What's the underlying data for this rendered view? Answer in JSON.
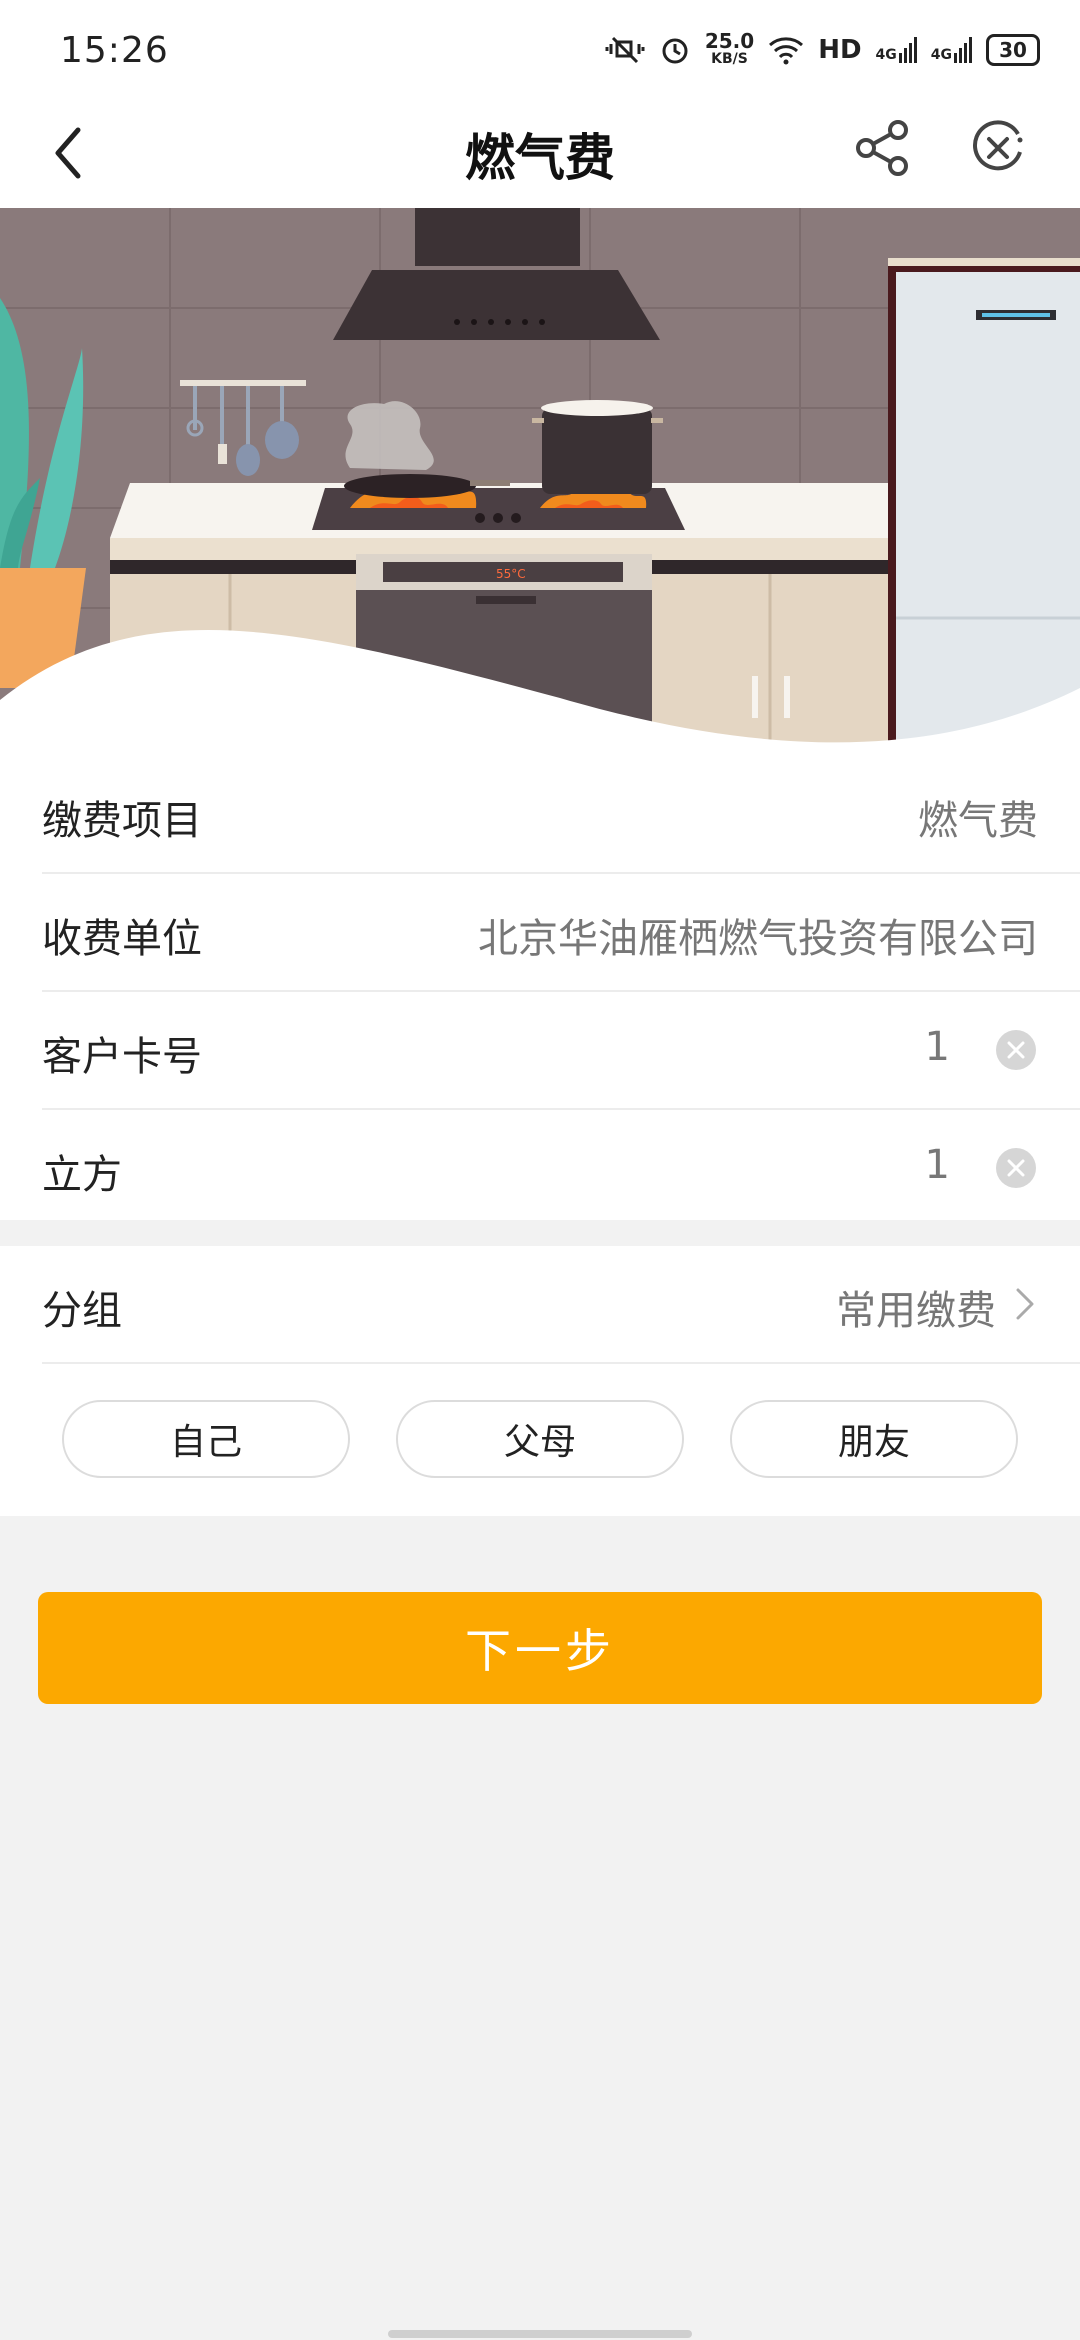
{
  "status": {
    "time": "15:26",
    "net_speed_value": "25.0",
    "net_speed_unit": "KB/S",
    "hd_label": "HD",
    "signal1_label": "4G",
    "signal2_label": "4G",
    "battery": "30"
  },
  "nav": {
    "title": "燃气费"
  },
  "banner": {
    "oven_display": "55°C"
  },
  "form": {
    "rows": [
      {
        "label": "缴费项目",
        "value": "燃气费"
      },
      {
        "label": "收费单位",
        "value": "北京华油雁栖燃气投资有限公司"
      },
      {
        "label": "客户卡号",
        "value": "1"
      },
      {
        "label": "立方",
        "value": "1"
      }
    ]
  },
  "group": {
    "label": "分组",
    "value": "常用缴费",
    "chips": [
      "自己",
      "父母",
      "朋友"
    ]
  },
  "actions": {
    "next_label": "下一步"
  },
  "colors": {
    "accent": "#fca800",
    "background": "#f2f2f2"
  }
}
